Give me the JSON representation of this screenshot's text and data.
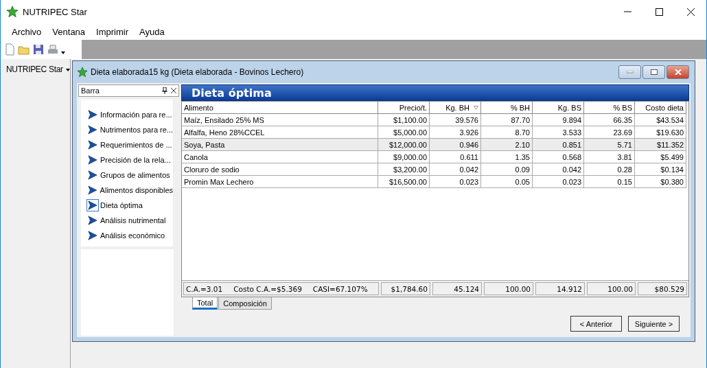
{
  "app": {
    "title": "NUTRIPEC Star"
  },
  "menu": [
    "Archivo",
    "Ventana",
    "Imprimir",
    "Ayuda"
  ],
  "side_menu": {
    "label": "NUTRIPEC Star"
  },
  "child_window": {
    "title": "Dieta elaborada15 kg (Dieta elaborada - Bovinos Lechero)"
  },
  "nav_panel": {
    "title": "Barra",
    "items": [
      {
        "label": "Información para re...",
        "selected": false
      },
      {
        "label": "Nutrimentos para re...",
        "selected": false
      },
      {
        "label": "Requerimientos de ...",
        "selected": false
      },
      {
        "label": "Precisión de la rela...",
        "selected": false
      },
      {
        "label": "Grupos de alimentos",
        "selected": false
      },
      {
        "label": "Alimentos disponibles",
        "selected": false
      },
      {
        "label": "Dieta óptima",
        "selected": true
      },
      {
        "label": "Análisis nutrimental",
        "selected": false
      },
      {
        "label": "Análisis económico",
        "selected": false
      }
    ]
  },
  "section_title": "Dieta óptima",
  "table": {
    "columns": [
      {
        "label": "Alimento",
        "sorted": false
      },
      {
        "label": "Precio/t.",
        "sorted": false
      },
      {
        "label": "Kg. BH",
        "sorted": true
      },
      {
        "label": "% BH",
        "sorted": false
      },
      {
        "label": "Kg. BS",
        "sorted": false
      },
      {
        "label": "% BS",
        "sorted": false
      },
      {
        "label": "Costo dieta",
        "sorted": false
      }
    ],
    "rows": [
      {
        "cells": [
          "Maíz, Ensilado 25% MS",
          "$1,100.00",
          "39.576",
          "87.70",
          "9.894",
          "66.35",
          "$43.534"
        ],
        "selected": false
      },
      {
        "cells": [
          "Alfalfa, Heno 28%CCEL",
          "$5,000.00",
          "3.926",
          "8.70",
          "3.533",
          "23.69",
          "$19.630"
        ],
        "selected": false
      },
      {
        "cells": [
          "Soya, Pasta",
          "$12,000.00",
          "0.946",
          "2.10",
          "0.851",
          "5.71",
          "$11.352"
        ],
        "selected": true
      },
      {
        "cells": [
          "Canola",
          "$9,000.00",
          "0.611",
          "1.35",
          "0.568",
          "3.81",
          "$5.499"
        ],
        "selected": false
      },
      {
        "cells": [
          "Cloruro de sodio",
          "$3,200.00",
          "0.042",
          "0.09",
          "0.042",
          "0.28",
          "$0.134"
        ],
        "selected": false
      },
      {
        "cells": [
          "Promin Max Lechero",
          "$16,500.00",
          "0.023",
          "0.05",
          "0.023",
          "0.15",
          "$0.380"
        ],
        "selected": false
      }
    ],
    "footer": {
      "summary": [
        "C.A.=3.01",
        "Costo C.A.=$5.369",
        "CASI=67.107%"
      ],
      "totals": [
        "$1,784.60",
        "45.124",
        "100.00",
        "14.912",
        "100.00",
        "$80.529"
      ]
    }
  },
  "tabs": [
    {
      "label": "Total",
      "selected": true
    },
    {
      "label": "Composición",
      "selected": false
    }
  ],
  "buttons": [
    "< Anterior",
    "Siguiente >"
  ]
}
